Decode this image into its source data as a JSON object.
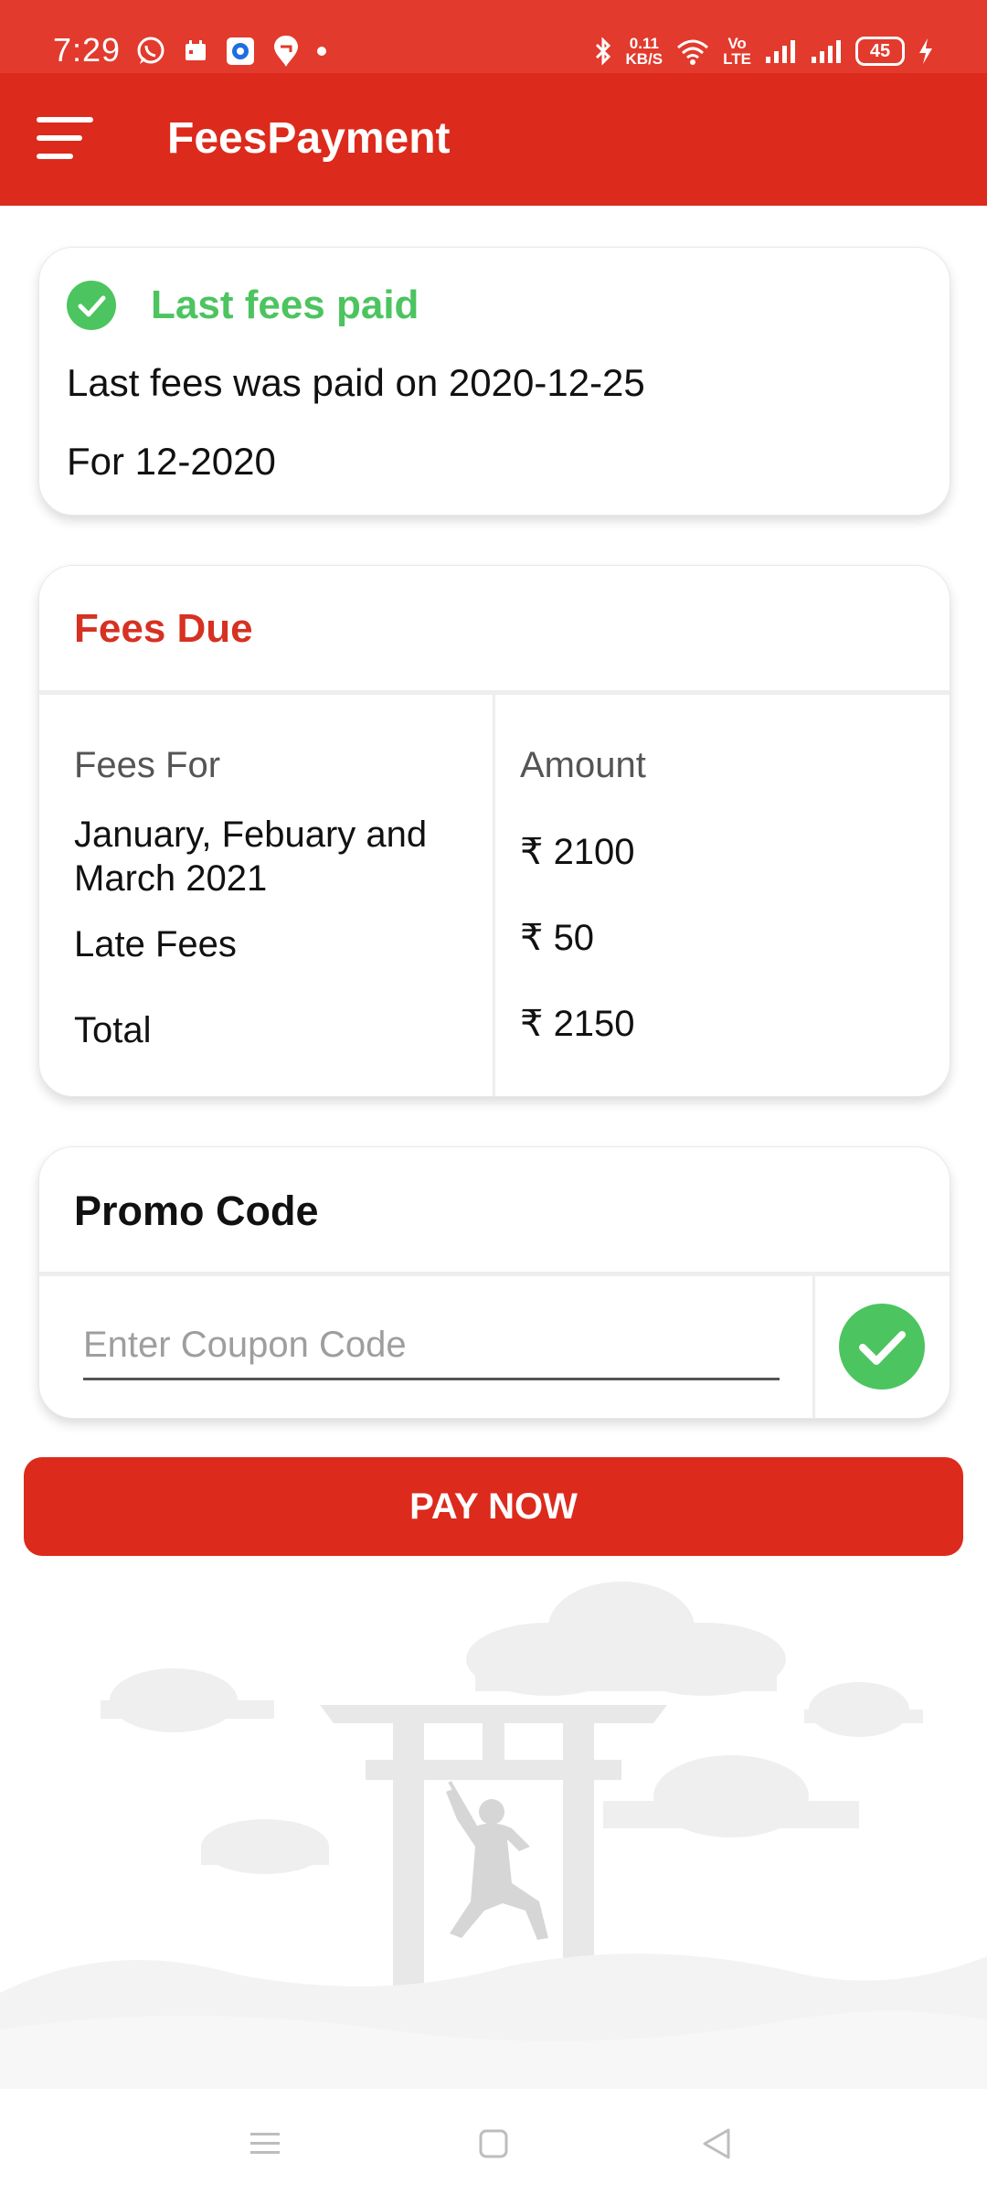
{
  "status_bar": {
    "time": "7:29",
    "net_speed_value": "0.11",
    "net_speed_unit": "KB/S",
    "volte_label_top": "Vo",
    "volte_label_bottom": "LTE",
    "battery_level": "45"
  },
  "app_bar": {
    "title": "FeesPayment"
  },
  "last_paid": {
    "heading": "Last fees paid",
    "paid_on_text": "Last fees was paid on 2020-12-25",
    "for_text": "For 12-2020"
  },
  "fees_due": {
    "heading": "Fees Due",
    "col_headers": [
      "Fees For",
      "Amount"
    ],
    "rows": [
      {
        "label": "January, Febuary and March 2021",
        "amount": "₹ 2100"
      },
      {
        "label": "Late Fees",
        "amount": "₹ 50"
      },
      {
        "label": "Total",
        "amount": "₹ 2150"
      }
    ]
  },
  "promo": {
    "heading": "Promo Code",
    "placeholder": "Enter Coupon Code"
  },
  "pay_button": {
    "label": "PAY NOW"
  },
  "colors": {
    "status_bar": "#e23a2d",
    "app_bar": "#dc2a1c",
    "success_green": "#4cc45f",
    "fees_due_red": "#d63122"
  },
  "icons": {
    "menu": "hamburger-menu-icon",
    "paid_check": "check-circle-icon",
    "apply_coupon": "check-circle-icon",
    "nav_recents": "recents-icon",
    "nav_home": "home-icon",
    "nav_back": "back-icon"
  }
}
